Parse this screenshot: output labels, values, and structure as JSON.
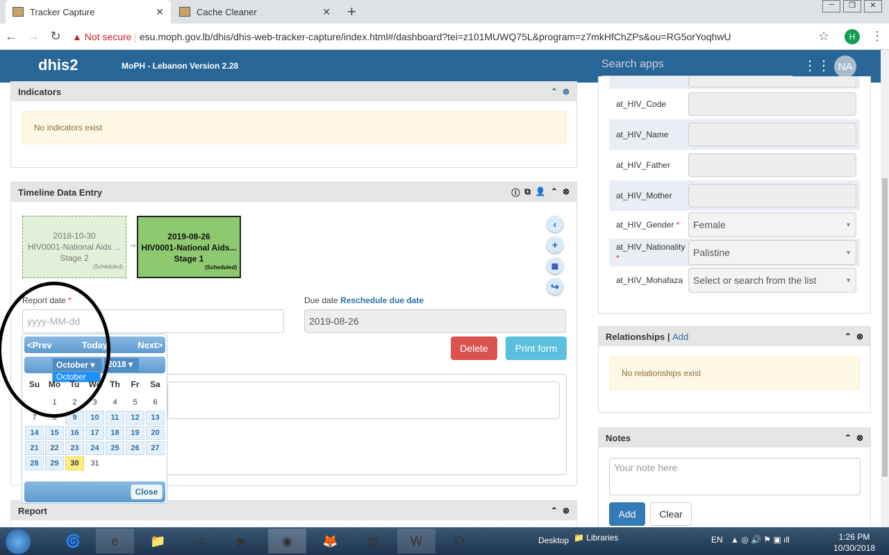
{
  "browser": {
    "tabs": [
      {
        "title": "Tracker Capture"
      },
      {
        "title": "Cache Cleaner"
      }
    ],
    "not_secure": "Not secure",
    "url": "esu.moph.gov.lb/dhis/dhis-web-tracker-capture/index.html#/dashboard?tei=z101MUWQ75L&program=z7mkHfChZPs&ou=RG5orYoqhwU",
    "profile_initial": "H"
  },
  "header": {
    "logo": "dhis2",
    "title": "MoPH - Lebanon Version 2.28",
    "search_placeholder": "Search apps",
    "user_initials": "NA"
  },
  "indicators": {
    "title": "Indicators",
    "message": "No indicators exist"
  },
  "timeline": {
    "title": "Timeline Data Entry",
    "stages": [
      {
        "date": "2018-10-30",
        "program": "HIV0001-National Aids ...",
        "stage": "Stage 2",
        "status": "(Scheduled)"
      },
      {
        "date": "2019-08-26",
        "program": "HIV0001-National Aids...",
        "stage": "Stage 1",
        "status": "(Scheduled)"
      }
    ],
    "report_date_label": "Report date",
    "report_date_placeholder": "yyyy-MM-dd",
    "due_date_label": "Due date",
    "reschedule_link": "Reschedule due date",
    "due_date_value": "2019-08-26",
    "delete": "Delete",
    "print": "Print form",
    "required": "*"
  },
  "calendar": {
    "prev": "<Prev",
    "today": "Today",
    "next": "Next>",
    "month": "October",
    "year": "2018",
    "month_option": "October",
    "weekdays": [
      "Su",
      "Mo",
      "Tu",
      "We",
      "Th",
      "Fr",
      "Sa"
    ],
    "close": "Close",
    "selected_day": "30",
    "days": [
      "",
      "1",
      "2",
      "3",
      "4",
      "5",
      "6",
      "7",
      "8",
      "9",
      "10",
      "11",
      "12",
      "13",
      "14",
      "15",
      "16",
      "17",
      "18",
      "19",
      "20",
      "21",
      "22",
      "23",
      "24",
      "25",
      "26",
      "27",
      "28",
      "29",
      "30",
      "31"
    ]
  },
  "report": {
    "title": "Report"
  },
  "profile": {
    "fields": [
      {
        "label": "at_HIV_Code",
        "value": ""
      },
      {
        "label": "at_HIV_Name",
        "value": ""
      },
      {
        "label": "at_HIV_Father",
        "value": ""
      },
      {
        "label": "at_HIV_Mother",
        "value": ""
      }
    ],
    "selects": [
      {
        "label": "at_HIV_Gender",
        "value": "Female"
      },
      {
        "label": "at_HIV_Nationality",
        "value": "Palistine"
      },
      {
        "label": "at_HIV_Mohafaza",
        "value": "Select or search from the list"
      }
    ]
  },
  "relationships": {
    "title": "Relationships",
    "add": "Add",
    "message": "No relationships exist"
  },
  "notes": {
    "title": "Notes",
    "placeholder": "Your note here",
    "add": "Add",
    "clear": "Clear"
  },
  "taskbar": {
    "desktop": "Desktop",
    "libraries": "Libraries",
    "lang": "EN",
    "time": "1:26 PM",
    "date": "10/30/2018"
  }
}
